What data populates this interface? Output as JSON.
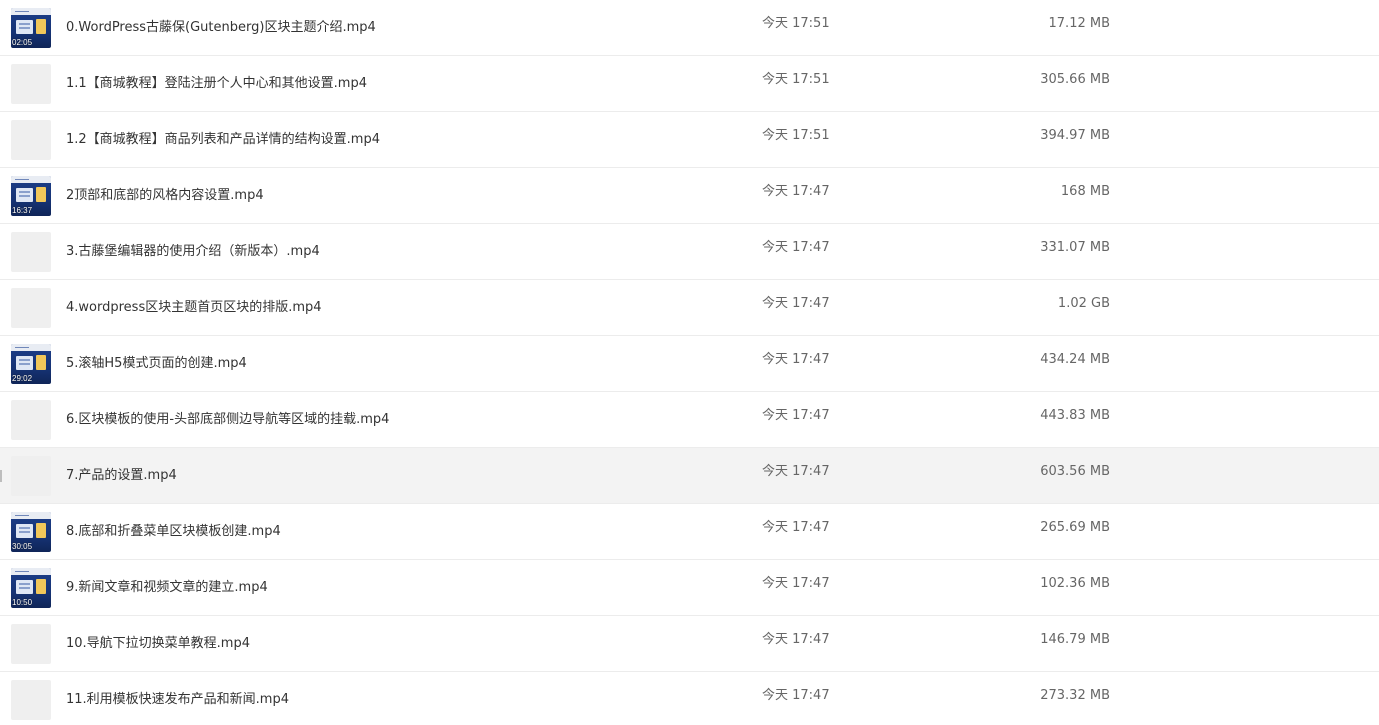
{
  "files": [
    {
      "name": "0.WordPress古藤保(Gutenberg)区块主题介绍.mp4",
      "time": "今天 17:51",
      "size": "17.12 MB",
      "thumb": "video",
      "duration": "02:05"
    },
    {
      "name": "1.1【商城教程】登陆注册个人中心和其他设置.mp4",
      "time": "今天 17:51",
      "size": "305.66 MB",
      "thumb": "placeholder",
      "duration": ""
    },
    {
      "name": "1.2【商城教程】商品列表和产品详情的结构设置.mp4",
      "time": "今天 17:51",
      "size": "394.97 MB",
      "thumb": "placeholder",
      "duration": ""
    },
    {
      "name": "2顶部和底部的风格内容设置.mp4",
      "time": "今天 17:47",
      "size": "168 MB",
      "thumb": "video",
      "duration": "16:37"
    },
    {
      "name": "3.古藤堡编辑器的使用介绍（新版本）.mp4",
      "time": "今天 17:47",
      "size": "331.07 MB",
      "thumb": "placeholder",
      "duration": ""
    },
    {
      "name": "4.wordpress区块主题首页区块的排版.mp4",
      "time": "今天 17:47",
      "size": "1.02 GB",
      "thumb": "placeholder",
      "duration": ""
    },
    {
      "name": "5.滚轴H5模式页面的创建.mp4",
      "time": "今天 17:47",
      "size": "434.24 MB",
      "thumb": "video",
      "duration": "29:02"
    },
    {
      "name": "6.区块模板的使用-头部底部侧边导航等区域的挂载.mp4",
      "time": "今天 17:47",
      "size": "443.83 MB",
      "thumb": "placeholder",
      "duration": ""
    },
    {
      "name": "7.产品的设置.mp4",
      "time": "今天 17:47",
      "size": "603.56 MB",
      "thumb": "placeholder",
      "duration": "",
      "hover": true
    },
    {
      "name": "8.底部和折叠菜单区块模板创建.mp4",
      "time": "今天 17:47",
      "size": "265.69 MB",
      "thumb": "video",
      "duration": "30:05"
    },
    {
      "name": "9.新闻文章和视频文章的建立.mp4",
      "time": "今天 17:47",
      "size": "102.36 MB",
      "thumb": "video",
      "duration": "10:50"
    },
    {
      "name": "10.导航下拉切换菜单教程.mp4",
      "time": "今天 17:47",
      "size": "146.79 MB",
      "thumb": "placeholder",
      "duration": ""
    },
    {
      "name": "11.利用模板快速发布产品和新闻.mp4",
      "time": "今天 17:47",
      "size": "273.32 MB",
      "thumb": "placeholder",
      "duration": ""
    }
  ]
}
